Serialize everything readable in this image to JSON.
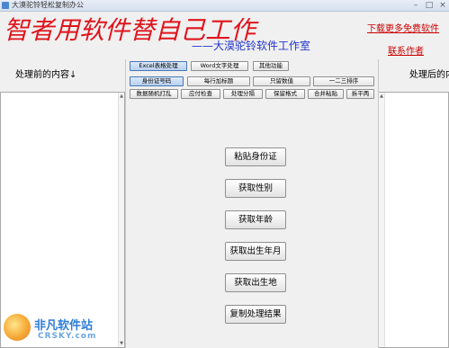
{
  "window": {
    "title": "大漠驼铃轻松复制办公"
  },
  "header": {
    "slogan": "智者用软件替自己工作",
    "studio": "——大漠驼铃软件工作室",
    "download_link": "下载更多免费软件",
    "contact_link": "联系作者"
  },
  "left_panel": {
    "label": "处理前的内容↓"
  },
  "right_panel": {
    "label": "处理后的内"
  },
  "tabs": {
    "excel": "Excel表格处理",
    "word": "Word文字处理",
    "other": "其他功能"
  },
  "subtabs_row1": [
    "身份证号码",
    "每行加标题",
    "只留数值",
    "一二三排序"
  ],
  "subtabs_row2": [
    "数据随机打乱",
    "应付检查",
    "处理分隔",
    "保留格式",
    "合并粘贴",
    "拆平两"
  ],
  "actions": {
    "paste_id": "粘贴身份证",
    "get_gender": "获取性别",
    "get_age": "获取年龄",
    "get_birth": "获取出生年月",
    "get_birthplace": "获取出生地",
    "copy_result": "复制处理结果"
  },
  "watermark": {
    "name": "非凡软件站",
    "sub": "CRSKY.com"
  }
}
